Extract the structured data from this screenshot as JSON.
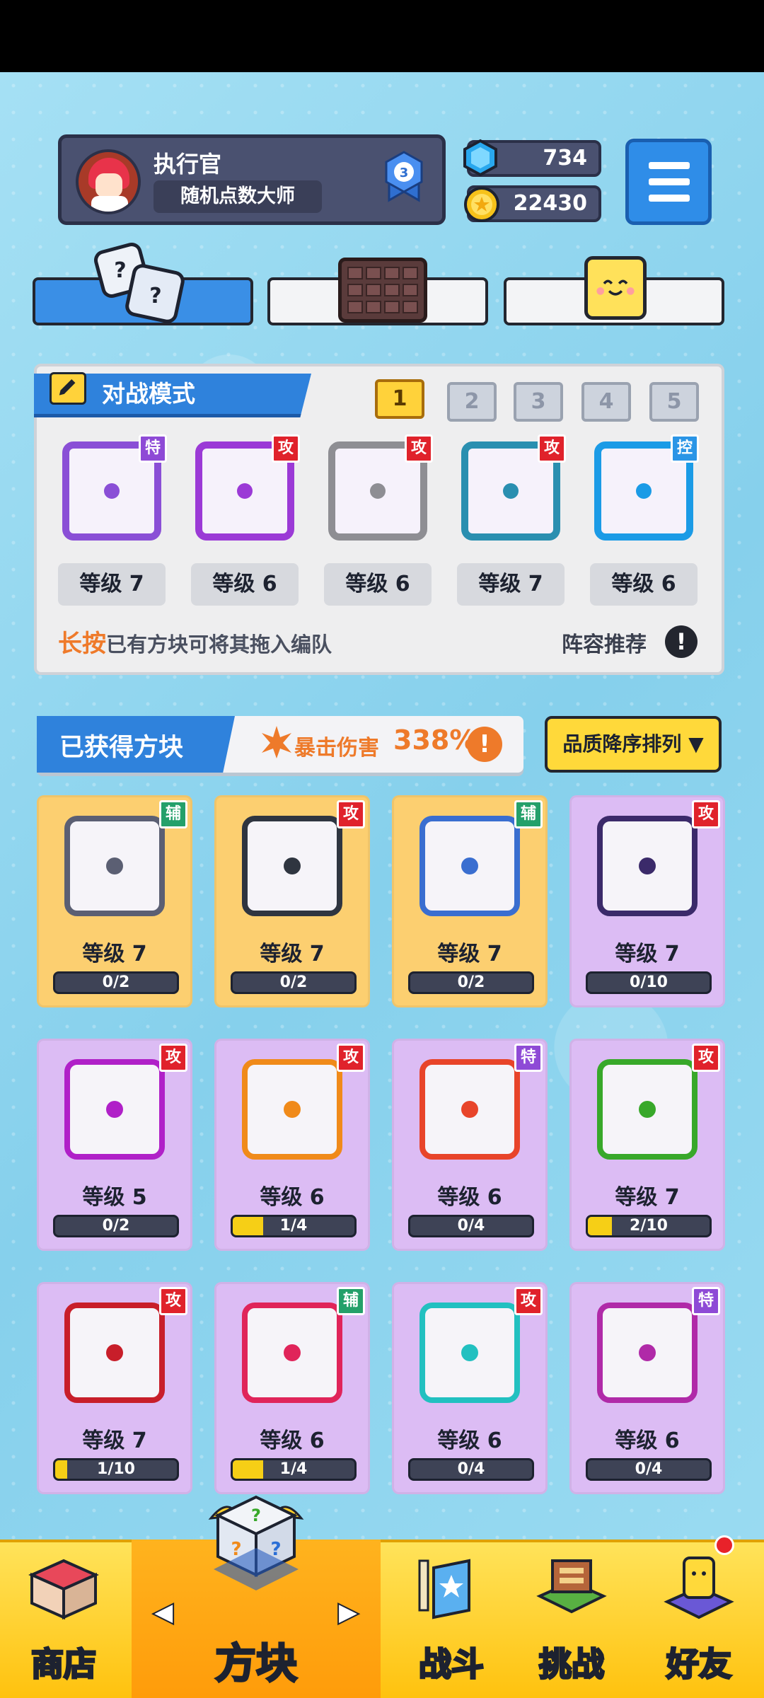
{
  "profile": {
    "name": "执行官",
    "title": "随机点数大师",
    "rank": "3"
  },
  "currency": {
    "gems": "734",
    "coins": "22430"
  },
  "battle_mode": {
    "title": "对战模式",
    "slots": [
      "1",
      "2",
      "3",
      "4",
      "5"
    ],
    "active_slot": "1",
    "deck": [
      {
        "tag": "特",
        "level": "等级 7",
        "color": "#8a4fd6"
      },
      {
        "tag": "攻",
        "level": "等级 6",
        "color": "#9b3ad6"
      },
      {
        "tag": "攻",
        "level": "等级 6",
        "color": "#8e8e93"
      },
      {
        "tag": "攻",
        "level": "等级 7",
        "color": "#2a8fb0"
      },
      {
        "tag": "控",
        "level": "等级 6",
        "color": "#1b9be6"
      }
    ],
    "hint_highlight": "长按",
    "hint_rest": "已有方块可将其拖入编队",
    "recommend": "阵容推荐",
    "info": "!"
  },
  "collection": {
    "title": "已获得方块",
    "crit_label": "暴击伤害",
    "crit_value": "338%",
    "info": "!",
    "sort": "品质降序排列",
    "cards": [
      {
        "tag": "辅",
        "level": "等级 7",
        "progress": "0/2",
        "fill": 0,
        "bg": "gold",
        "border": "#5b5f73"
      },
      {
        "tag": "攻",
        "level": "等级 7",
        "progress": "0/2",
        "fill": 0,
        "bg": "gold",
        "border": "#2f3540"
      },
      {
        "tag": "辅",
        "level": "等级 7",
        "progress": "0/2",
        "fill": 0,
        "bg": "gold",
        "border": "#3a6ed0"
      },
      {
        "tag": "攻",
        "level": "等级 7",
        "progress": "0/10",
        "fill": 0,
        "bg": "purple",
        "border": "#3b2a6a"
      },
      {
        "tag": "攻",
        "level": "等级 5",
        "progress": "0/2",
        "fill": 0,
        "bg": "purple",
        "border": "#b020c8"
      },
      {
        "tag": "攻",
        "level": "等级 6",
        "progress": "1/4",
        "fill": 0.25,
        "bg": "purple",
        "border": "#f08a1a"
      },
      {
        "tag": "特",
        "level": "等级 6",
        "progress": "0/4",
        "fill": 0,
        "bg": "purple",
        "border": "#e8442a"
      },
      {
        "tag": "攻",
        "level": "等级 7",
        "progress": "2/10",
        "fill": 0.2,
        "bg": "purple",
        "border": "#38a82a"
      },
      {
        "tag": "攻",
        "level": "等级 7",
        "progress": "1/10",
        "fill": 0.1,
        "bg": "purple",
        "border": "#c81e2a"
      },
      {
        "tag": "辅",
        "level": "等级 6",
        "progress": "1/4",
        "fill": 0.25,
        "bg": "purple",
        "border": "#e0245a"
      },
      {
        "tag": "攻",
        "level": "等级 6",
        "progress": "0/4",
        "fill": 0,
        "bg": "purple",
        "border": "#22c0c0"
      },
      {
        "tag": "特",
        "level": "等级 6",
        "progress": "0/4",
        "fill": 0,
        "bg": "purple",
        "border": "#b02aa8"
      }
    ]
  },
  "nav": {
    "shop": "商店",
    "blocks": "方块",
    "battle": "战斗",
    "challenge": "挑战",
    "friends": "好友",
    "left_arrow": "◀",
    "right_arrow": "▶"
  }
}
